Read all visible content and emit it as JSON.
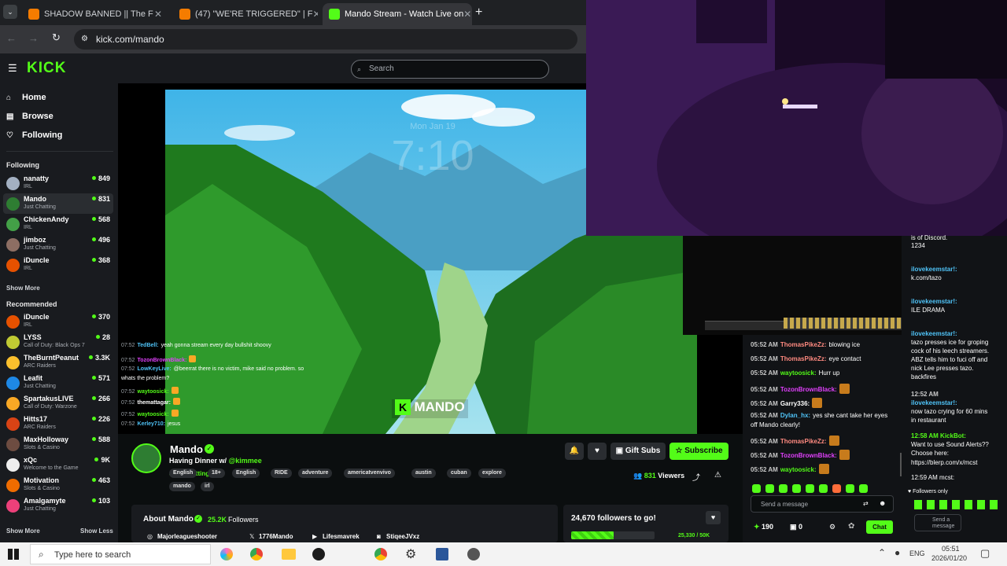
{
  "browser": {
    "tabs": [
      {
        "label": "SHADOW BANNED || The F",
        "favicon_color": "#f57c00"
      },
      {
        "label": "(47) \"WE'RE TRIGGERED\" | F",
        "favicon_color": "#f57c00"
      },
      {
        "label": "Mando Stream - Watch Live on",
        "favicon_color": "#53fc18"
      }
    ],
    "url": "kick.com/mando"
  },
  "kick": {
    "logo": "KICK",
    "search_placeholder": "Search",
    "nav": [
      {
        "label": "Home",
        "icon": "home-icon"
      },
      {
        "label": "Browse",
        "icon": "browse-icon"
      },
      {
        "label": "Following",
        "icon": "heart-icon"
      }
    ],
    "following_title": "Following",
    "following": [
      {
        "name": "nanatty",
        "cat": "IRL",
        "viewers": "849",
        "color": "#a3b0c2"
      },
      {
        "name": "Mando",
        "cat": "Just Chatting",
        "viewers": "831",
        "color": "#2e7d32"
      },
      {
        "name": "ChickenAndy",
        "cat": "IRL",
        "viewers": "568",
        "color": "#43a047"
      },
      {
        "name": "jimboz",
        "cat": "Just Chatting",
        "viewers": "496",
        "color": "#8d6e63"
      },
      {
        "name": "iDuncle",
        "cat": "IRL",
        "viewers": "368",
        "color": "#e65100"
      }
    ],
    "show_more_1": "Show More",
    "recommended_title": "Recommended",
    "recommended": [
      {
        "name": "iDuncle",
        "cat": "IRL",
        "viewers": "370",
        "color": "#e65100"
      },
      {
        "name": "LYSS",
        "cat": "Call of Duty: Black Ops 7",
        "viewers": "28",
        "color": "#c0ca33"
      },
      {
        "name": "TheBurntPeanut",
        "cat": "ARC Raiders",
        "viewers": "3.3K",
        "color": "#fbc02d"
      },
      {
        "name": "Leafit",
        "cat": "Just Chatting",
        "viewers": "571",
        "color": "#1e88e5"
      },
      {
        "name": "SpartakusLIVE",
        "cat": "Call of Duty: Warzone",
        "viewers": "266",
        "color": "#f9a825"
      },
      {
        "name": "Hitts17",
        "cat": "ARC Raiders",
        "viewers": "226",
        "color": "#d84315"
      },
      {
        "name": "MaxHolloway",
        "cat": "Slots & Casino",
        "viewers": "588",
        "color": "#6d4c41"
      },
      {
        "name": "xQc",
        "cat": "Welcome to the Game",
        "viewers": "9K",
        "color": "#eeeeee"
      },
      {
        "name": "Motivation",
        "cat": "Slots & Casino",
        "viewers": "463",
        "color": "#ef6c00"
      },
      {
        "name": "Amalgamyte",
        "cat": "Just Chatting",
        "viewers": "103",
        "color": "#ec407a"
      }
    ],
    "show_more_2": "Show More",
    "show_less": "Show Less"
  },
  "video": {
    "lock_date": "Mon Jan 19",
    "lock_time": "7:10",
    "watermark": "MANDO",
    "overlay_chat": [
      {
        "time": "07:52",
        "user": "TedBell:",
        "user_color": "#4fc3f7",
        "msg": "yeah gonna stream every day bullshit shoovy"
      },
      {
        "time": "07:52",
        "user": "TozonBrownBlack:",
        "user_color": "#e040fb",
        "msg": ""
      },
      {
        "time": "07:52",
        "user": "LowKeyLive:",
        "user_color": "#4fc3f7",
        "msg": "@beerrat there is no victim, mike said no problem. so"
      },
      {
        "time": "",
        "user": "",
        "user_color": "#ffffff",
        "msg": "whats the problem?"
      },
      {
        "time": "07:52",
        "user": "waytoosick:",
        "user_color": "#53fc18",
        "msg": ""
      },
      {
        "time": "07:52",
        "user": "themattagar:",
        "user_color": "#ffffff",
        "msg": ""
      },
      {
        "time": "07:52",
        "user": "waytoosick:",
        "user_color": "#53fc18",
        "msg": ""
      },
      {
        "time": "07:52",
        "user": "Kerley710:",
        "user_color": "#4fc3f7",
        "msg": "jesus"
      }
    ]
  },
  "stream": {
    "name": "Mando",
    "title": "Having Dinner w/ ",
    "title_mention": "@kimmee",
    "category": "Just Chatting",
    "tags": [
      "English",
      "18+",
      "English",
      "RIDE",
      "adventure",
      "americatvenvivo",
      "austin",
      "cuban",
      "explore",
      "mando",
      "irl"
    ],
    "viewers": "831",
    "viewers_label": "Viewers",
    "gift_subs": "Gift Subs",
    "subscribe": "Subscribe",
    "about_title": "About Mando",
    "followers": "25.2K",
    "followers_label": "Followers",
    "socials": [
      "Majorleagueshooter",
      "1776Mando",
      "Lifesmavrek",
      "StiqeeJVxz"
    ],
    "goal_text": "24,670 followers to go!",
    "goal_progress": "25,330 / 50K",
    "goal_fraction": 0.5066
  },
  "chat": {
    "messages": [
      {
        "time": "05:52 AM",
        "user": "ThomasPikeZz:",
        "user_color": "#ff8a80",
        "msg": "blowing ice"
      },
      {
        "time": "05:52 AM",
        "user": "ThomasPikeZz:",
        "user_color": "#ff8a80",
        "msg": "eye contact"
      },
      {
        "time": "05:52 AM",
        "user": "waytoosick:",
        "user_color": "#53fc18",
        "msg": "Hurr up"
      },
      {
        "time": "05:52 AM",
        "user": "TozonBrownBlack:",
        "user_color": "#e040fb",
        "msg": ""
      },
      {
        "time": "05:52 AM",
        "user": "Garry336:",
        "user_color": "#ffffff",
        "msg": ""
      },
      {
        "time": "05:52 AM",
        "user": "Dylan_hx:",
        "user_color": "#4fc3f7",
        "msg": "yes she cant take her eyes"
      },
      {
        "time": "",
        "user": "",
        "user_color": "#ffffff",
        "msg": "off Mando clearly!"
      },
      {
        "time": "05:52 AM",
        "user": "ThomasPikeZz:",
        "user_color": "#ff8a80",
        "msg": ""
      },
      {
        "time": "05:52 AM",
        "user": "TozonBrownBlack:",
        "user_color": "#e040fb",
        "msg": ""
      },
      {
        "time": "05:52 AM",
        "user": "waytoosick:",
        "user_color": "#53fc18",
        "msg": ""
      }
    ],
    "send_placeholder": "Send a message",
    "points": "190",
    "zero": "0",
    "chat_button": "Chat"
  },
  "rightchat": {
    "lines": [
      {
        "text": "is of Discord.",
        "color": "#ffffff"
      },
      {
        "text": "1234",
        "color": "#ffffff"
      },
      {
        "text": "ilovekeemstar!:",
        "color": "#4fc3f7"
      },
      {
        "text": "k.com/tazo",
        "color": "#ffffff"
      },
      {
        "text": "ilovekeemstar!:",
        "color": "#4fc3f7"
      },
      {
        "text": "ILE DRAMA",
        "color": "#ffffff"
      },
      {
        "text": "ilovekeemstar!:",
        "color": "#4fc3f7"
      },
      {
        "text": "tazo presses ice for groping",
        "color": "#ffffff"
      },
      {
        "text": "cock of his leech streamers.",
        "color": "#ffffff"
      },
      {
        "text": "ABZ tells him to fuci off and",
        "color": "#ffffff"
      },
      {
        "text": "nick Lee presses tazo.",
        "color": "#ffffff"
      },
      {
        "text": "backfires",
        "color": "#ffffff"
      },
      {
        "text": "12:52 AM",
        "color": "#c8c8c8"
      },
      {
        "text": "ilovekeemstar!:",
        "color": "#4fc3f7"
      },
      {
        "text": "now tazo crying for 60 mins",
        "color": "#ffffff"
      },
      {
        "text": "in restaurant",
        "color": "#ffffff"
      },
      {
        "text": "12:58 AM  KickBot:",
        "color": "#53fc18"
      },
      {
        "text": "Want to use Sound Alerts??",
        "color": "#ffffff"
      },
      {
        "text": "Choose here:",
        "color": "#ffffff"
      },
      {
        "text": "https://blerp.com/x/mcst",
        "color": "#ffffff"
      },
      {
        "text": "12:59 AM  mcst:",
        "color": "#ffffff"
      }
    ],
    "followers_only": "Followers only",
    "send": "Send a message"
  },
  "taskbar": {
    "search": "Type here to search",
    "lang": "ENG",
    "time": "05:51",
    "date": "2026/01/20"
  }
}
